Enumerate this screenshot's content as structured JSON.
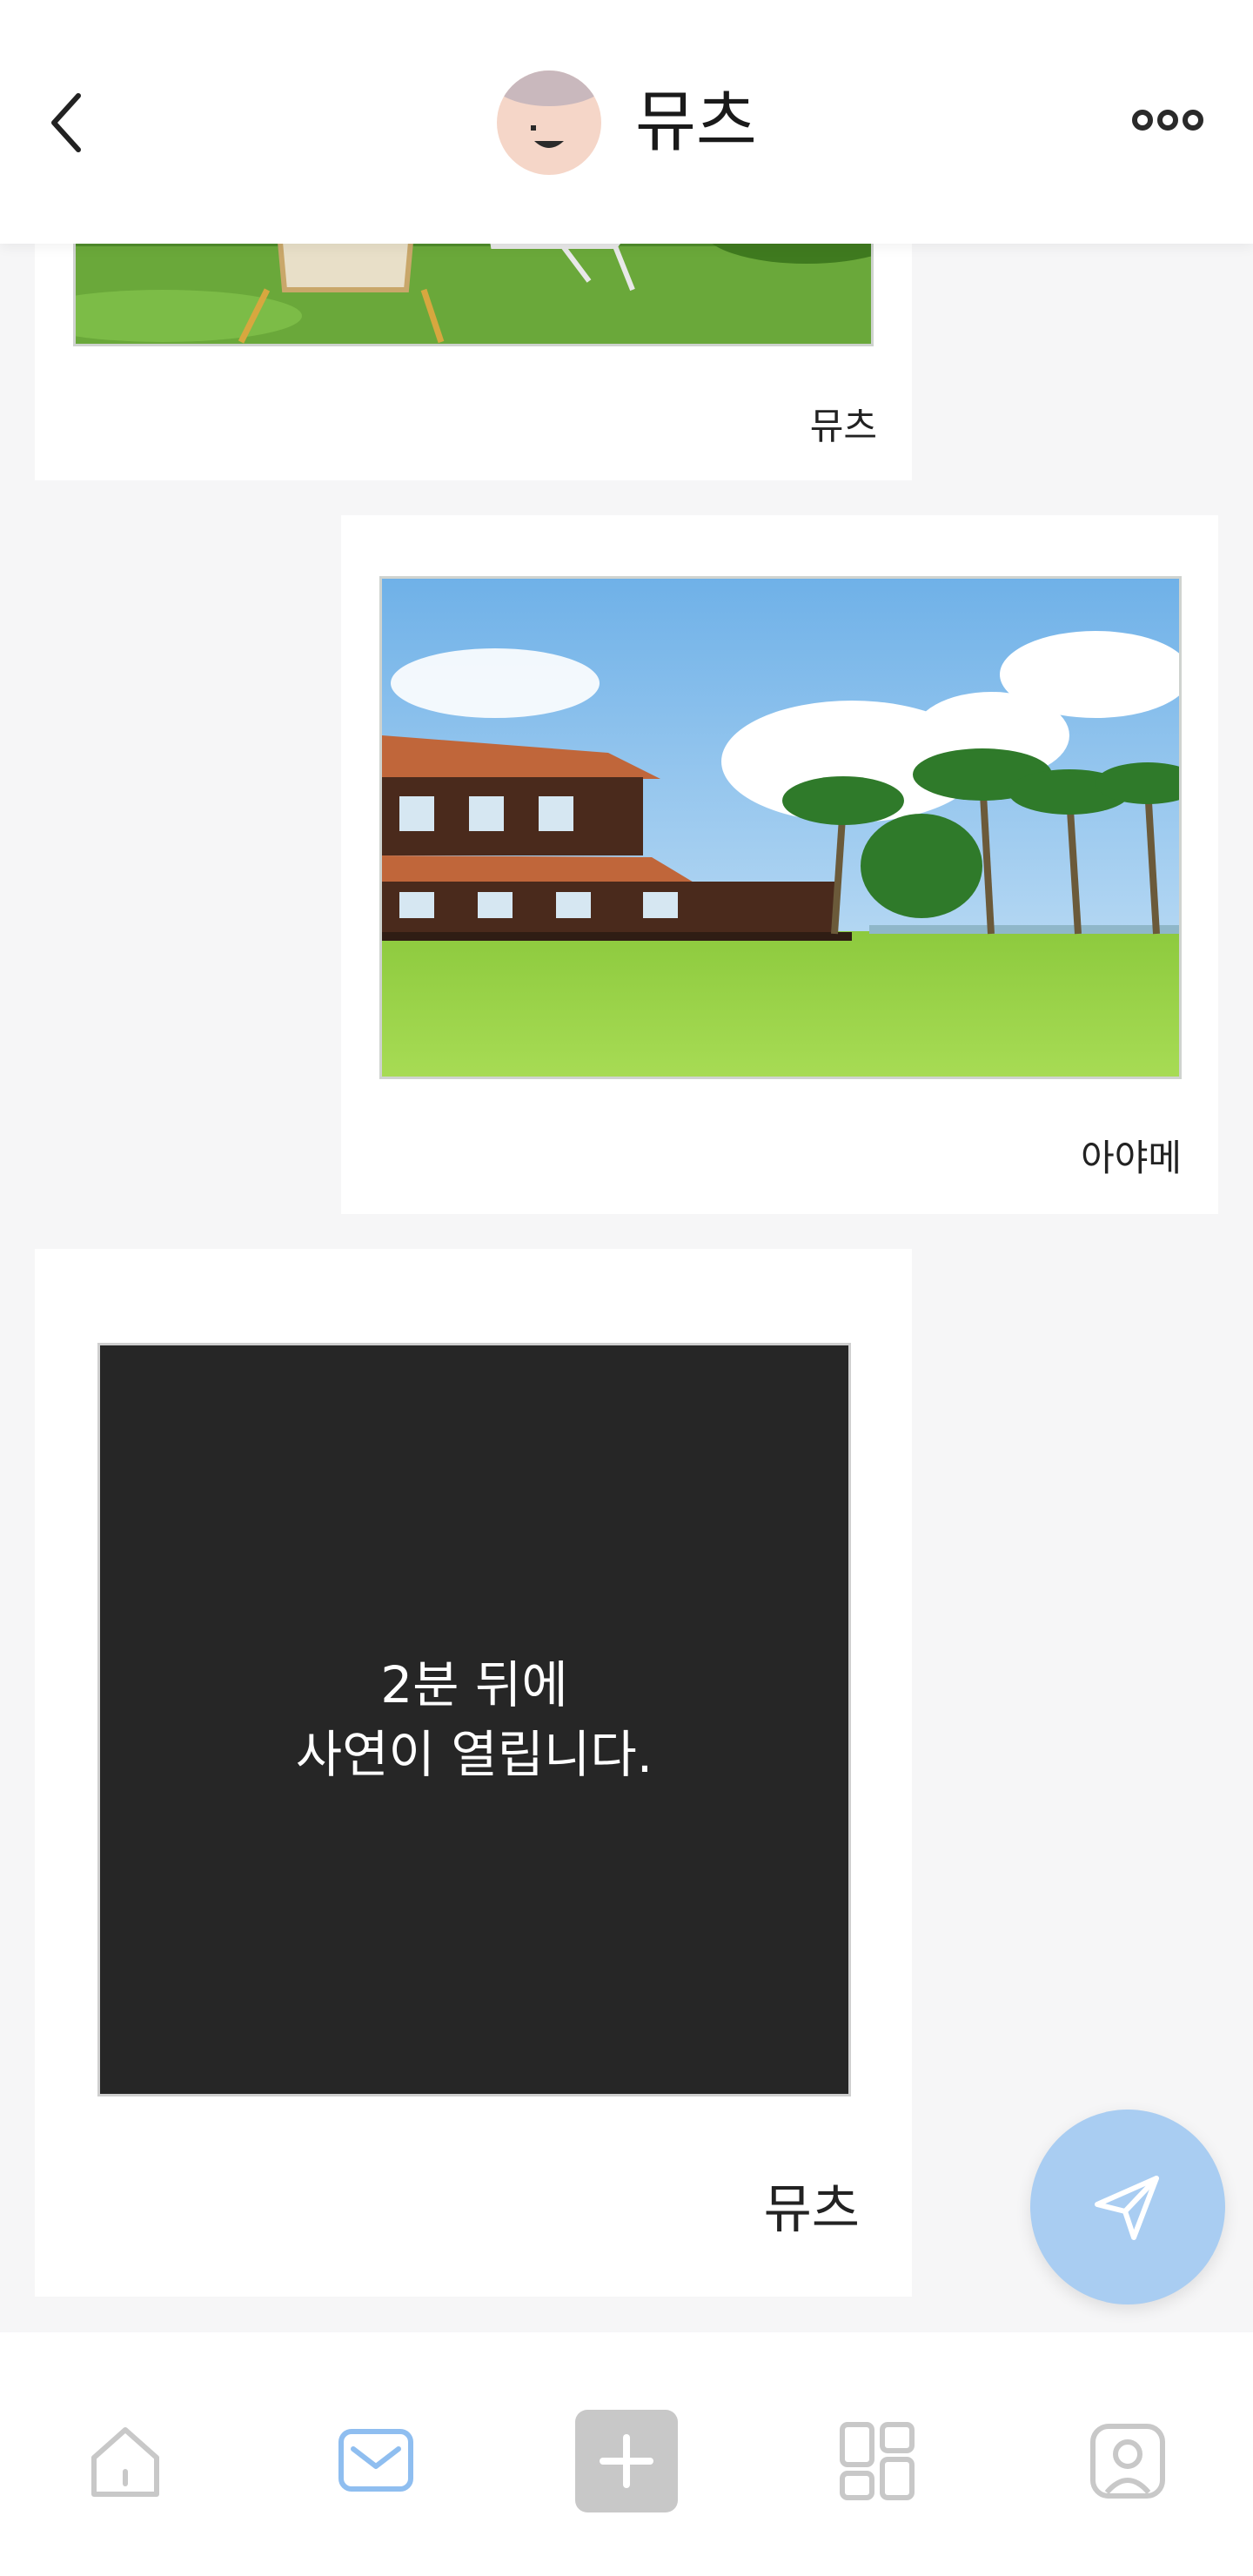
{
  "header": {
    "title": "뮤츠",
    "back_icon": "chevron-left-icon",
    "more_icon": "more-horizontal-icon",
    "avatar_icon": "smiling-face-avatar"
  },
  "messages": [
    {
      "sender": "뮤츠",
      "type": "photo",
      "alignment": "left",
      "image": "lawn-with-deck-chairs"
    },
    {
      "sender": "아야메",
      "type": "photo",
      "alignment": "right",
      "image": "wooden-resort-with-palm-trees"
    },
    {
      "sender": "뮤츠",
      "type": "locked",
      "alignment": "left",
      "locked_text_line1": "2분 뒤에",
      "locked_text_line2": "사연이 열립니다."
    }
  ],
  "send_button": {
    "icon": "paper-plane-icon",
    "color": "#a9cdf2"
  },
  "tabbar": {
    "items": [
      {
        "id": "home",
        "icon": "home-icon",
        "active": false
      },
      {
        "id": "inbox",
        "icon": "mail-icon",
        "active": true
      },
      {
        "id": "add",
        "icon": "plus-icon",
        "active": false
      },
      {
        "id": "apps",
        "icon": "grid-icon",
        "active": false
      },
      {
        "id": "profile",
        "icon": "user-icon",
        "active": false
      }
    ],
    "active_color": "#8fbef0",
    "inactive_color": "#c8c8c8"
  }
}
